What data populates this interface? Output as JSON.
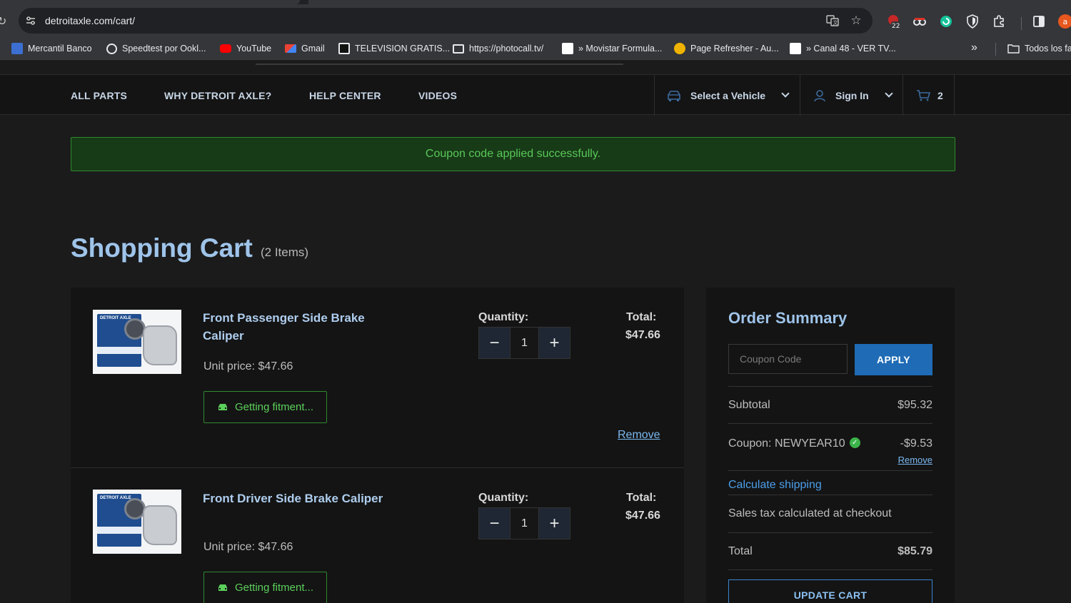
{
  "browser": {
    "url": "detroitaxle.com/cart/",
    "extension_badge": "22",
    "profile_initial": "a",
    "bookmarks": [
      {
        "label": "Mercantil Banco",
        "color": "#3c6fd1"
      },
      {
        "label": "Speedtest por Ookl...",
        "color": "#e8eaed"
      },
      {
        "label": "YouTube",
        "color": "#ff0000"
      },
      {
        "label": "Gmail",
        "color": "#ea4335"
      },
      {
        "label": "TELEVISION GRATIS...",
        "color": "#c62828"
      },
      {
        "label": "https://photocall.tv/",
        "color": "#e8eaed"
      },
      {
        "label": "» Movistar Formula...",
        "color": "#ffffff"
      },
      {
        "label": "Page Refresher - Au...",
        "color": "#f0b400"
      },
      {
        "label": "» Canal 48 - VER TV...",
        "color": "#ffffff"
      }
    ],
    "bookmarks_folder": "Todos los fa"
  },
  "nav": {
    "links": [
      "ALL PARTS",
      "WHY DETROIT AXLE?",
      "HELP CENTER",
      "VIDEOS"
    ],
    "vehicle": "Select a Vehicle",
    "sign_in": "Sign In",
    "cart_count": "2"
  },
  "alert": "Coupon code applied successfully.",
  "cart": {
    "title": "Shopping Cart",
    "count": "(2 Items)",
    "qty_label": "Quantity:",
    "total_label": "Total:",
    "fitment_label": "Getting fitment...",
    "remove_label": "Remove",
    "items": [
      {
        "name_line1": "Front Passenger Side Brake",
        "name_line2": "Caliper",
        "unit_price": "Unit price: $47.66",
        "quantity": "1",
        "total": "$47.66"
      },
      {
        "name_line1": "Front Driver Side Brake Caliper",
        "name_line2": "",
        "unit_price": "Unit price: $47.66",
        "quantity": "1",
        "total": "$47.66"
      }
    ],
    "thumb_label": "DETROIT AXLE"
  },
  "summary": {
    "title": "Order Summary",
    "coupon_placeholder": "Coupon Code",
    "apply": "APPLY",
    "subtotal_label": "Subtotal",
    "subtotal": "$95.32",
    "coupon_label": "Coupon: NEWYEAR10",
    "coupon_value": "-$9.53",
    "coupon_remove": "Remove",
    "calc_shipping": "Calculate shipping",
    "tax_note": "Sales tax calculated at checkout",
    "total_label": "Total",
    "total": "$85.79",
    "update": "UPDATE CART"
  }
}
